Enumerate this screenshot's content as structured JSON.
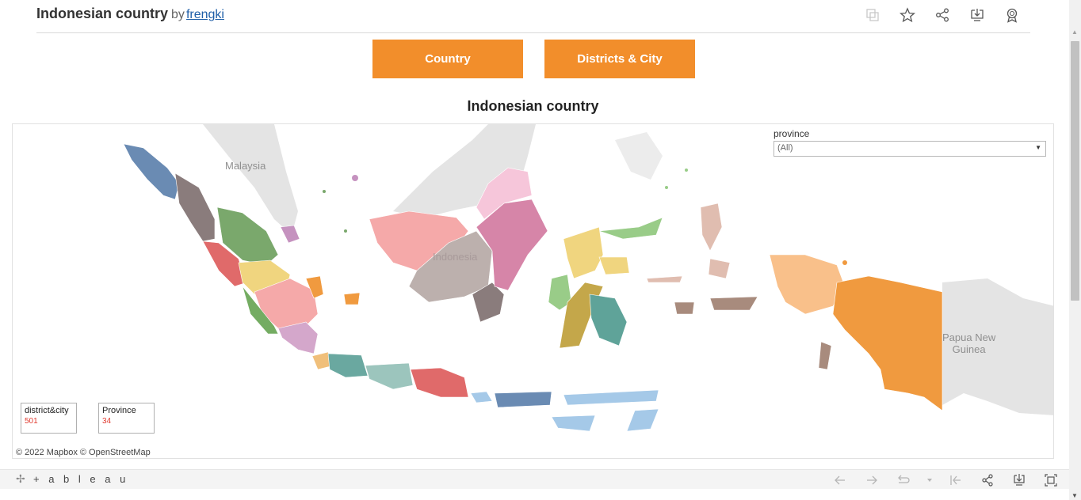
{
  "header": {
    "title": "Indonesian country",
    "by": "by",
    "author": "frengki",
    "icons": [
      "copy-icon",
      "star-icon",
      "share-icon",
      "download-icon",
      "badge-icon"
    ]
  },
  "nav": {
    "country_label": "Country",
    "districts_label": "Districts & City"
  },
  "dashboard_title": "Indonesian country",
  "filter": {
    "label": "province",
    "value": "(All)"
  },
  "map": {
    "labels": {
      "malaysia": "Malaysia",
      "indonesia": "Indonesia",
      "png_line1": "Papua New",
      "png_line2": "Guinea"
    },
    "attribution": "© 2022 Mapbox  © OpenStreetMap"
  },
  "kpis": {
    "district_label": "district&city",
    "district_value": "501",
    "province_label": "Province",
    "province_value": "34"
  },
  "toolbar": {
    "brand": "+ a b l e a u",
    "icons": [
      "undo-icon",
      "redo-icon",
      "revert-icon",
      "revert-dropdown-icon",
      "reset-icon",
      "share-icon",
      "download-icon",
      "fullscreen-icon"
    ]
  },
  "colors": {
    "accent": "#f28e2b",
    "link": "#1f5fa8",
    "kpi_value": "#e03a2f"
  }
}
